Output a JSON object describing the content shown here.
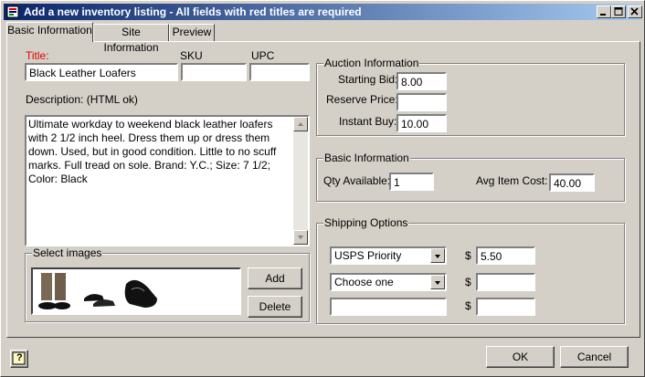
{
  "window": {
    "title": "Add a new inventory listing - All fields with red titles are required"
  },
  "tabs": [
    {
      "label": "Basic Information"
    },
    {
      "label": "Site Information"
    },
    {
      "label": "Preview"
    }
  ],
  "basic": {
    "title_label": "Title:",
    "title_value": "Black Leather Loafers",
    "sku_label": "SKU",
    "sku_value": "",
    "upc_label": "UPC",
    "upc_value": "",
    "description_label": "Description: (HTML ok)",
    "description_value": "Ultimate workday to weekend black leather loafers with 2 1/2 inch heel. Dress them up or dress them down. Used, but in good condition. Little to no scuff marks. Full tread on sole. Brand: Y.C.; Size: 7 1/2; Color: Black"
  },
  "images": {
    "group_title": "Select images",
    "add_label": "Add",
    "delete_label": "Delete"
  },
  "auction": {
    "group_title": "Auction Information",
    "starting_bid_label": "Starting Bid:",
    "starting_bid_value": "8.00",
    "reserve_price_label": "Reserve Price:",
    "reserve_price_value": "",
    "instant_buy_label": "Instant Buy:",
    "instant_buy_value": "10.00"
  },
  "basic_info": {
    "group_title": "Basic Information",
    "qty_label": "Qty Available:",
    "qty_value": "1",
    "avg_cost_label": "Avg Item Cost:",
    "avg_cost_value": "40.00"
  },
  "shipping": {
    "group_title": "Shipping Options",
    "currency": "$",
    "rows": [
      {
        "method": "USPS Priority",
        "price": "5.50",
        "has_dropdown": true
      },
      {
        "method": "Choose one",
        "price": "",
        "has_dropdown": true
      },
      {
        "method": "",
        "price": "",
        "has_dropdown": false
      }
    ]
  },
  "footer": {
    "ok_label": "OK",
    "cancel_label": "Cancel",
    "help_label": "?"
  },
  "colors": {
    "required_label": "#e00000",
    "titlebar_start": "#0a246a",
    "titlebar_end": "#a6caf0"
  }
}
